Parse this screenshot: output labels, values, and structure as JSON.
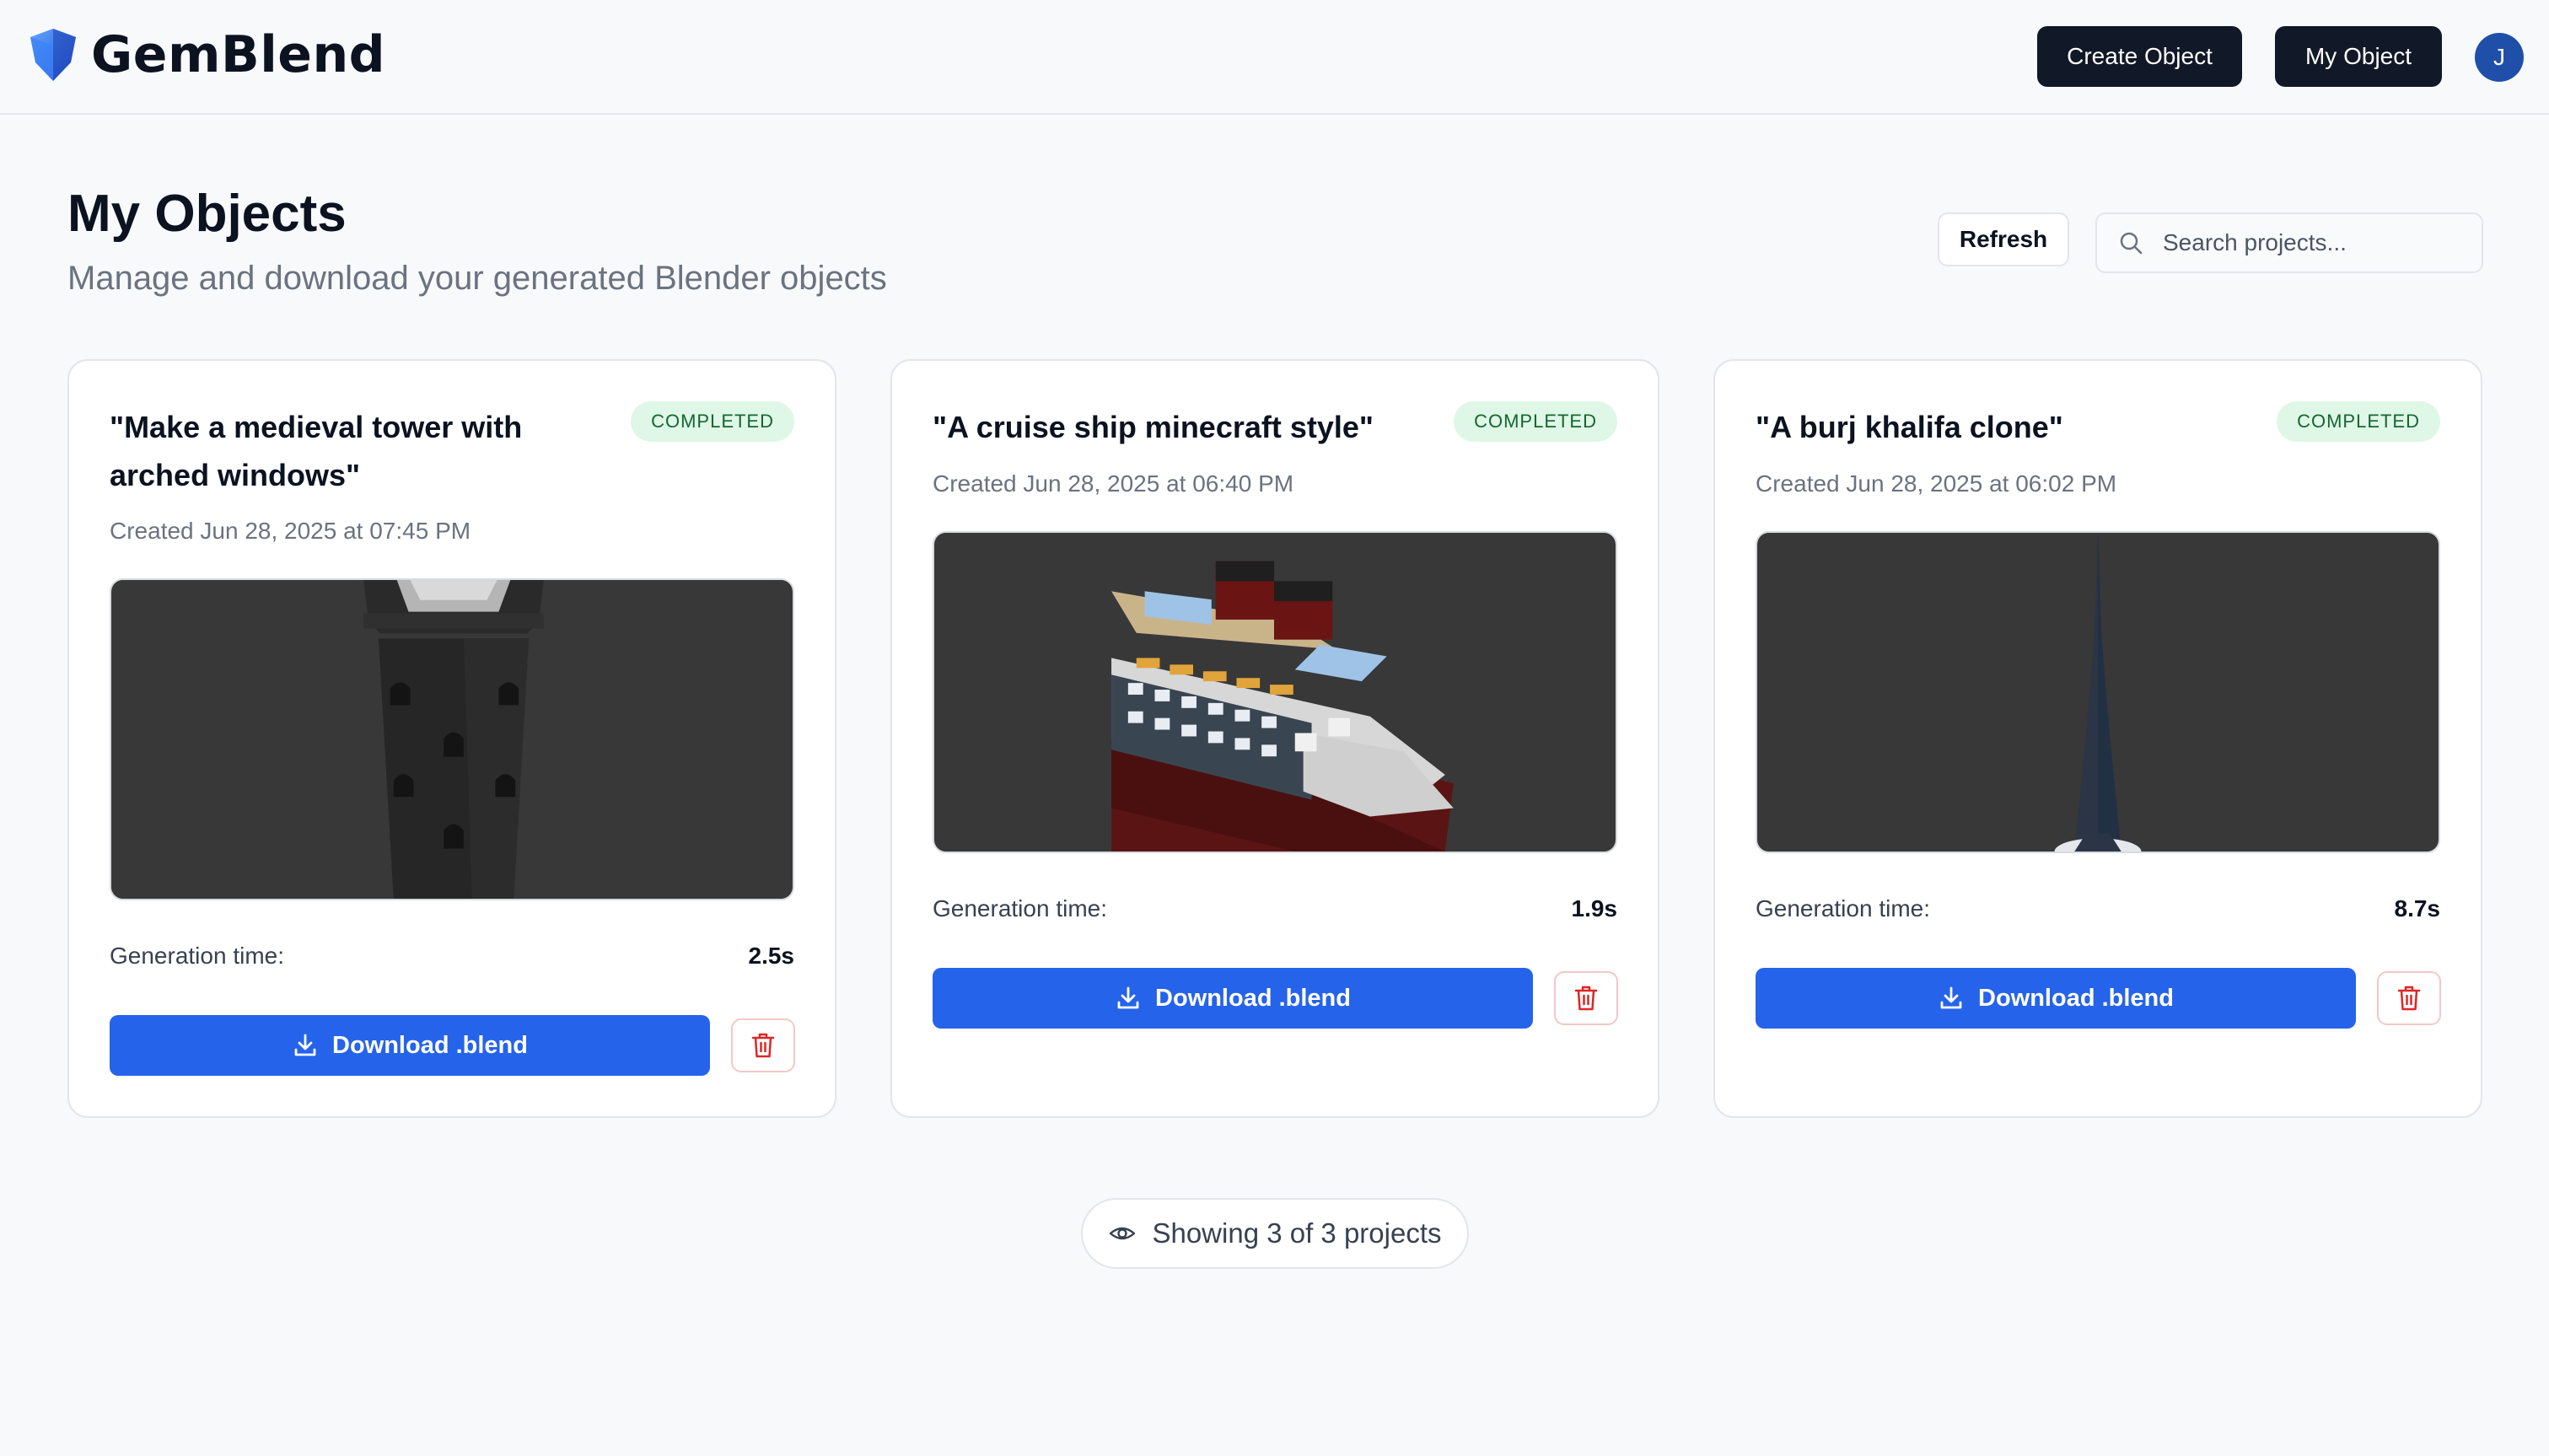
{
  "app": {
    "name": "GemBlend",
    "logo_icon": "gem-shield-icon",
    "brand_color": "#2563eb"
  },
  "header": {
    "create_label": "Create Object",
    "my_object_label": "My Object",
    "avatar_initial": "J"
  },
  "page": {
    "title": "My Objects",
    "subtitle": "Manage and download your generated Blender objects",
    "refresh_label": "Refresh",
    "search_placeholder": "Search projects..."
  },
  "labels": {
    "generation_time": "Generation time:",
    "download": "Download .blend"
  },
  "projects": [
    {
      "title": "\"Make a medieval tower with arched windows\"",
      "status": "COMPLETED",
      "created": "Created Jun 28, 2025 at 07:45 PM",
      "generation_time": "2.5s",
      "preview": "medieval-tower-render"
    },
    {
      "title": "\"A cruise ship minecraft style\"",
      "status": "COMPLETED",
      "created": "Created Jun 28, 2025 at 06:40 PM",
      "generation_time": "1.9s",
      "preview": "cruise-ship-render"
    },
    {
      "title": "\"A burj khalifa clone\"",
      "status": "COMPLETED",
      "created": "Created Jun 28, 2025 at 06:02 PM",
      "generation_time": "8.7s",
      "preview": "burj-khalifa-render"
    }
  ],
  "footer": {
    "showing_text": "Showing 3 of 3 projects"
  },
  "colors": {
    "status_bg": "#dff7e6",
    "status_text": "#166534",
    "delete": "#dc2626",
    "dark_button": "#111827"
  }
}
